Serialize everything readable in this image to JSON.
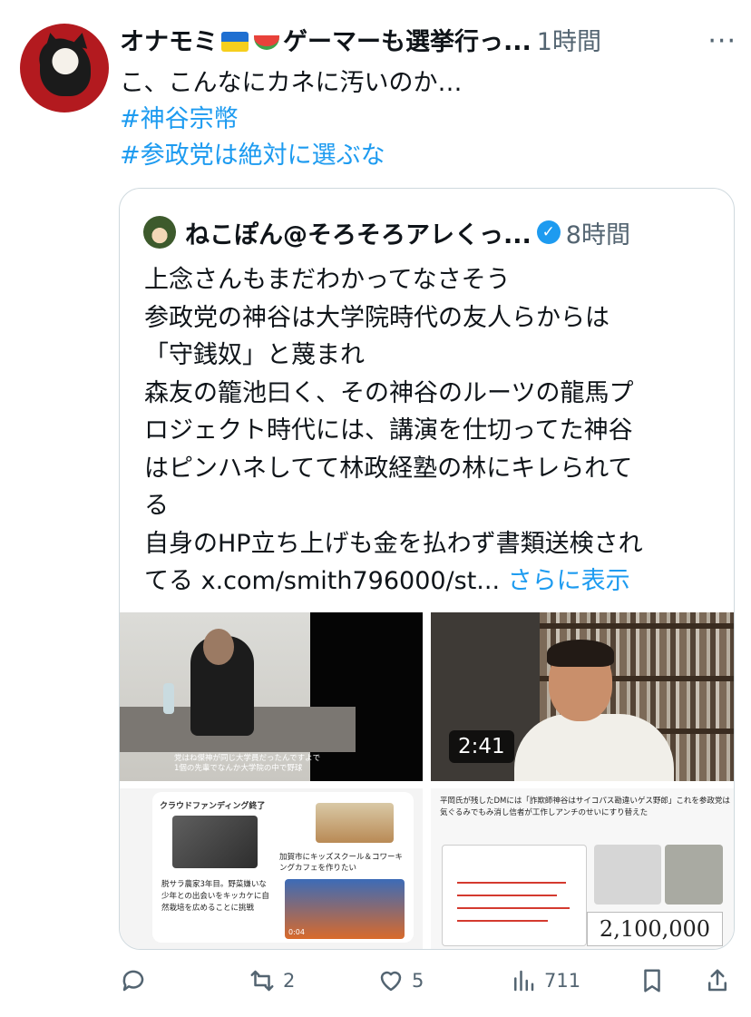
{
  "tweet": {
    "author_name": "オナモミ",
    "author_name_suffix": "ゲーマーも選挙行っ...",
    "time": "1時間",
    "more": "···",
    "text": "こ、こんなにカネに汚いのか…",
    "hashtags": [
      "#神谷宗幣",
      "#参政党は絶対に選ぶな"
    ]
  },
  "quote": {
    "author_name": "ねこぽん@そろそろアレくっ...",
    "verified_symbol": "✓",
    "time": "8時間",
    "lines": [
      "上念さんもまだわかってなさそう",
      "参政党の神谷は大学院時代の友人らからは",
      "「守銭奴」と蔑まれ",
      "森友の籠池曰く、その神谷のルーツの龍馬プ",
      "ロジェクト時代には、講演を仕切ってた神谷",
      "はピンハネしてて林政経塾の林にキレられて",
      "る",
      "自身のHP立ち上げも金を払わず書類送検され"
    ],
    "last_line_prefix": "てる ",
    "link": "x.com/smith796000/st...",
    "show_more": "さらに表示"
  },
  "media": {
    "tile1_subtitle_1": "党はね傑神が同じ大学員だったんですよで",
    "tile1_subtitle_2": "1個の先輩でなんか大学院の中で野球",
    "tile2_duration": "2:41",
    "tile3_title": "クラウドファンディング終了",
    "tile3_subtitle": "加賀市にキッズスクール＆コワーキングカフェを作りたい",
    "tile3_body": "脱サラ農家3年目。野菜嫌いな少年との出会いをキッカケに自然栽培を広めることに挑戦",
    "tile3_video_time": "0:04",
    "tile4_text": "平岡氏が残したDMには「詐欺師神谷はサイコパス勘違いゲス野郎」これを参政党は気ぐるみでもみ消し信者が工作しアンチのせいにすり替えた",
    "tile4_price": "2,100,000"
  },
  "actions": {
    "reply_count": "",
    "retweet_count": "2",
    "like_count": "5",
    "views_count": "711"
  }
}
